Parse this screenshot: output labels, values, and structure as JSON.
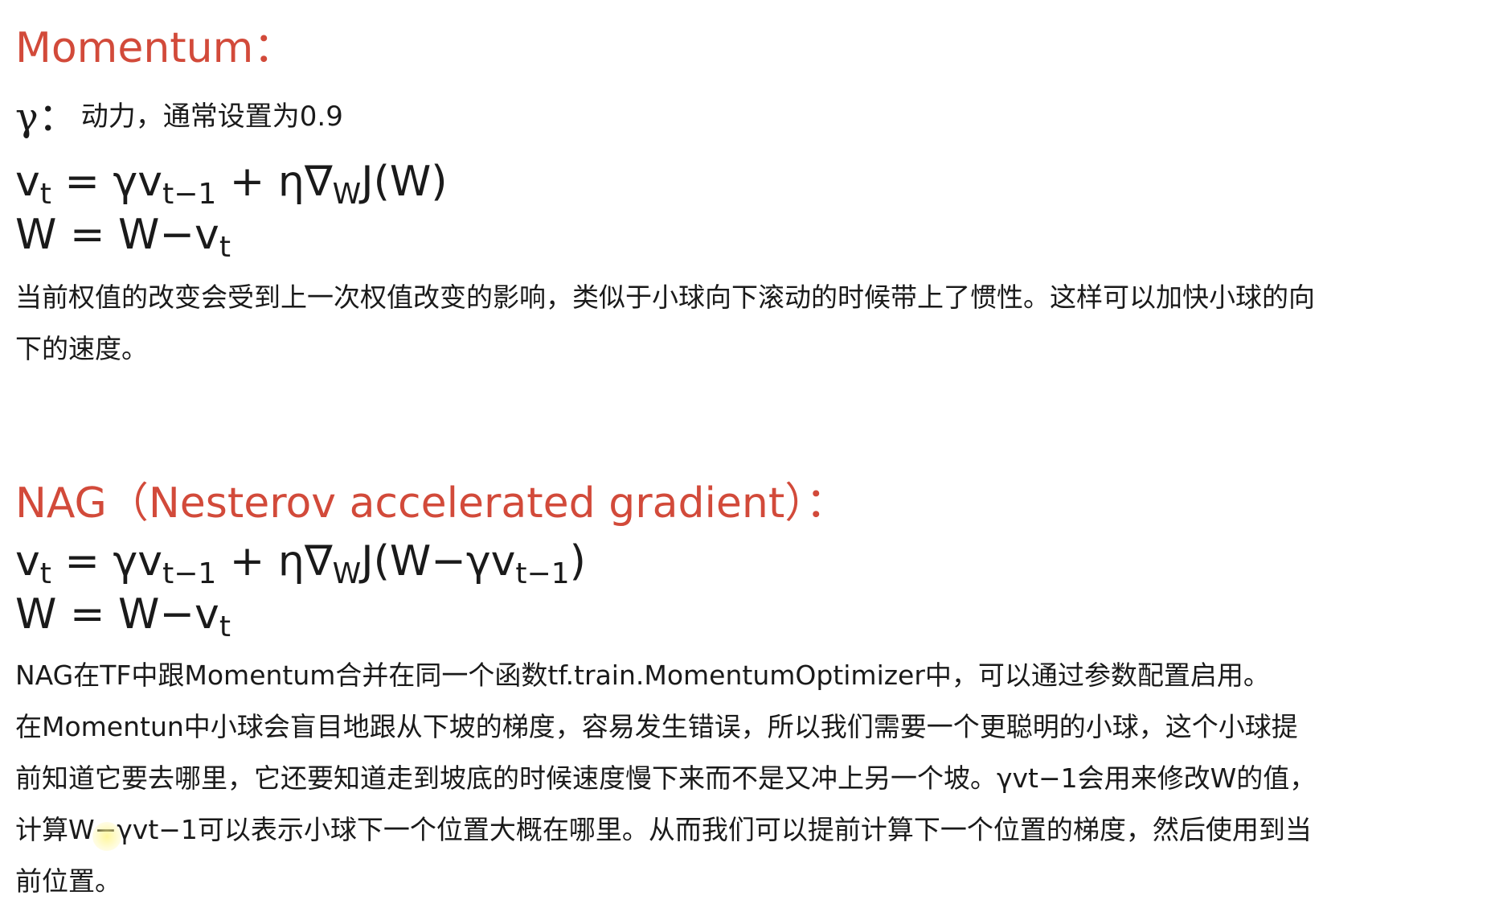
{
  "momentum": {
    "heading": "Momentum：",
    "gamma_symbol": "γ：",
    "gamma_desc": "动力，通常设置为0.9",
    "formula1": {
      "v": "v",
      "t": "t",
      "eq": " = γv",
      "t1": "t−1",
      "rest": " + η∇",
      "w": "W",
      "end": "J(W)"
    },
    "formula2": {
      "start": "W = W−v",
      "t": "t"
    },
    "description_lines": [
      "当前权值的改变会受到上一次权值改变的影响，类似于小球向下滚动的时候带上了惯性。这样可以加快小球的向",
      "下的速度。"
    ]
  },
  "nag": {
    "heading": "NAG（Nesterov accelerated gradient）：",
    "formula1": {
      "v": "v",
      "t": "t",
      "eq": " = γv",
      "t1": "t−1",
      "rest": " + η∇",
      "w": "W",
      "mid": "J(W−γv",
      "t1b": "t−1",
      "end": ")"
    },
    "formula2": {
      "start": "W = W−v",
      "t": "t"
    },
    "description_lines": [
      "NAG在TF中跟Momentum合并在同一个函数tf.train.MomentumOptimizer中，可以通过参数配置启用。",
      "在Momentun中小球会盲目地跟从下坡的梯度，容易发生错误，所以我们需要一个更聪明的小球，这个小球提",
      "前知道它要去哪里，它还要知道走到坡底的时候速度慢下来而不是又冲上另一个坡。γvt−1会用来修改W的值，",
      "计算W−γvt−1可以表示小球下一个位置大概在哪里。从而我们可以提前计算下一个位置的梯度，然后使用到当",
      "前位置。"
    ]
  },
  "colors": {
    "heading": "#d24a3a",
    "text": "#1a1a1a",
    "background": "#ffffff"
  }
}
